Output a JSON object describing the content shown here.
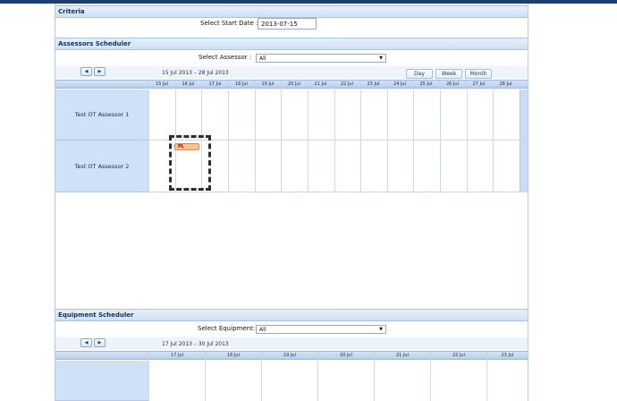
{
  "criteria": {
    "header": "Criteria",
    "start_date_label": "Select Start Date :",
    "start_date_value": "2013-07-15"
  },
  "assessors": {
    "header": "Assessors Scheduler",
    "select_label": "Select Assessor :",
    "select_value": "All",
    "date_range": "15 Jul 2013 – 28 Jul 2013",
    "view_buttons": [
      "Day",
      "Week",
      "Month"
    ],
    "days": [
      "15 Jul",
      "16 Jul",
      "17 Jul",
      "18 Jul",
      "19 Jul",
      "20 Jul",
      "21 Jul",
      "22 Jul",
      "23 Jul",
      "24 Jul",
      "25 Jul",
      "26 Jul",
      "27 Jul",
      "28 Jul"
    ],
    "rows": [
      "Test OT Assessor 1",
      "Test OT Assessor 2"
    ],
    "event_label": "PL"
  },
  "equipment": {
    "header": "Equipment Scheduler",
    "select_label": "Select Equipment:",
    "select_value": "All",
    "date_range": "17 Jul 2013 – 30 Jul 2013",
    "days": [
      "17 Jul",
      "18 Jul",
      "19 Jul",
      "20 Jul",
      "21 Jul",
      "22 Jul",
      "23 Jul"
    ]
  },
  "icons": {
    "prev": "arrow-left-icon",
    "next": "arrow-right-icon",
    "dropdown": "chevron-down-icon"
  },
  "colors": {
    "topbar": "#1e3f6e",
    "header_band": "#cfe0f4",
    "row_label_bg": "#cfe1f7",
    "event_fill": "#f8c48d",
    "event_text": "#b40000"
  }
}
